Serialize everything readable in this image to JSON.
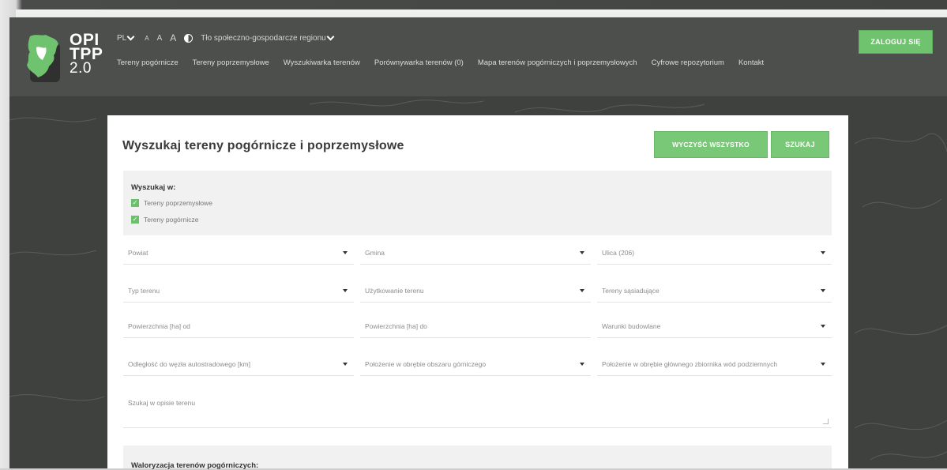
{
  "header": {
    "logo": {
      "line1": "OPI",
      "line2": "TPP",
      "line3": "2.0"
    },
    "language": "PL",
    "font_sizes": [
      "A",
      "A",
      "A"
    ],
    "contrast_icon": "contrast-icon",
    "region_select": "Tło społeczno-gospodarcze regionu",
    "nav": [
      "Tereny pogórnicze",
      "Tereny poprzemysłowe",
      "Wyszukiwarka terenów",
      "Porównywarka terenów (0)",
      "Mapa terenów pogórniczych i poprzemysłowych",
      "Cyfrowe repozytorium",
      "Kontakt"
    ],
    "login_label": "ZALOGUJ SIĘ"
  },
  "search": {
    "title": "Wyszukaj tereny pogórnicze i poprzemysłowe",
    "clear_label": "WYCZYŚĆ WSZYSTKO",
    "search_label": "SZUKAJ",
    "search_in_label": "Wyszukaj w:",
    "checkboxes": [
      {
        "label": "Tereny poprzemysłowe",
        "checked": true
      },
      {
        "label": "Tereny pogórnicze",
        "checked": true
      }
    ],
    "fields": [
      "Powiat",
      "Gmina",
      "Ulica (206)",
      "Typ terenu",
      "Użytkowanie terenu",
      "Tereny sąsiadujące",
      "Powierzchnia [ha] od",
      "Powierzchnia [ha] do",
      "Warunki budowlane",
      "Odległość do węzła autostradowego [km]",
      "Położenie w obrębie obszaru górniczego",
      "Położenie w obrębie głównego zbiornika wód podziemnych"
    ],
    "description_placeholder": "Szukaj w opisie terenu",
    "valorization_label": "Waloryzacja terenów pogórniczych:"
  },
  "colors": {
    "accent_green": "#78c877",
    "header_bg": "#4d4f4d",
    "map_bg": "#3f413f"
  }
}
